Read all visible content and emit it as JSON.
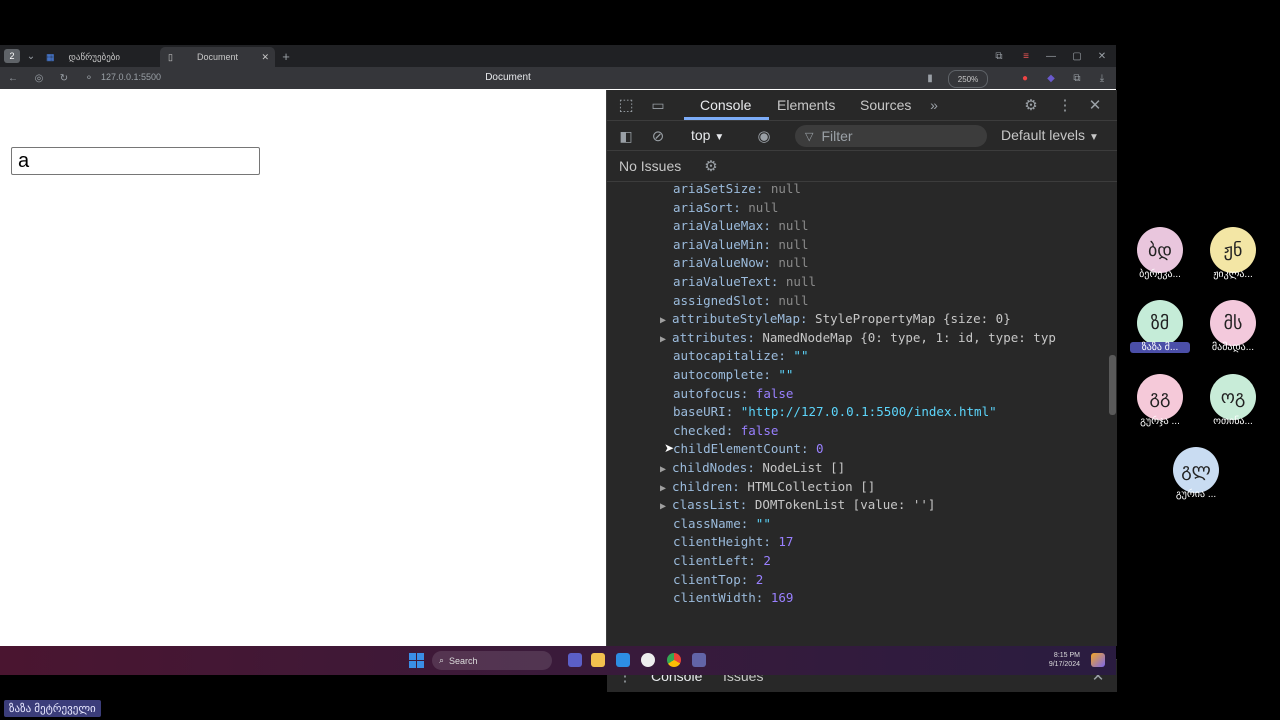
{
  "browser": {
    "tabs": [
      {
        "label": "დაწრუებები"
      },
      {
        "label": "Document"
      }
    ],
    "url": "127.0.0.1:5500",
    "page_title": "Document",
    "zoom": "250%"
  },
  "page": {
    "input_value": "a"
  },
  "devtools": {
    "tabs": [
      "Console",
      "Elements",
      "Sources"
    ],
    "context": "top",
    "filter_placeholder": "Filter",
    "levels": "Default levels",
    "issues": "No Issues",
    "drawer_tabs": [
      "Console",
      "Issues"
    ],
    "rows": [
      {
        "key": "ariaSetSize",
        "value": "null",
        "type": "null",
        "expand": false
      },
      {
        "key": "ariaSort",
        "value": "null",
        "type": "null",
        "expand": false
      },
      {
        "key": "ariaValueMax",
        "value": "null",
        "type": "null",
        "expand": false
      },
      {
        "key": "ariaValueMin",
        "value": "null",
        "type": "null",
        "expand": false
      },
      {
        "key": "ariaValueNow",
        "value": "null",
        "type": "null",
        "expand": false
      },
      {
        "key": "ariaValueText",
        "value": "null",
        "type": "null",
        "expand": false
      },
      {
        "key": "assignedSlot",
        "value": "null",
        "type": "null",
        "expand": false
      },
      {
        "key": "attributeStyleMap",
        "value": "StylePropertyMap {size: 0}",
        "type": "obj",
        "expand": true
      },
      {
        "key": "attributes",
        "value": "NamedNodeMap {0: type, 1: id, type: typ",
        "type": "obj",
        "expand": true
      },
      {
        "key": "autocapitalize",
        "value": "\"\"",
        "type": "str",
        "expand": false
      },
      {
        "key": "autocomplete",
        "value": "\"\"",
        "type": "str",
        "expand": false
      },
      {
        "key": "autofocus",
        "value": "false",
        "type": "bool",
        "expand": false
      },
      {
        "key": "baseURI",
        "value": "\"http://127.0.0.1:5500/index.html\"",
        "type": "str",
        "expand": false
      },
      {
        "key": "checked",
        "value": "false",
        "type": "bool",
        "expand": false
      },
      {
        "key": "childElementCount",
        "value": "0",
        "type": "num",
        "expand": false
      },
      {
        "key": "childNodes",
        "value": "NodeList []",
        "type": "obj",
        "expand": true
      },
      {
        "key": "children",
        "value": "HTMLCollection []",
        "type": "obj",
        "expand": true
      },
      {
        "key": "classList",
        "value": "DOMTokenList [value: '']",
        "type": "obj",
        "expand": true
      },
      {
        "key": "className",
        "value": "\"\"",
        "type": "str",
        "expand": false
      },
      {
        "key": "clientHeight",
        "value": "17",
        "type": "num",
        "expand": false
      },
      {
        "key": "clientLeft",
        "value": "2",
        "type": "num",
        "expand": false
      },
      {
        "key": "clientTop",
        "value": "2",
        "type": "num",
        "expand": false
      },
      {
        "key": "clientWidth",
        "value": "169",
        "type": "num",
        "expand": false
      }
    ]
  },
  "taskbar": {
    "search": "Search",
    "time": "8:15 PM",
    "date": "9/17/2024"
  },
  "participants": [
    {
      "initials": "ბდ",
      "name": "ბერეკა...",
      "color": "#e9c6dd"
    },
    {
      "initials": "ჟნ",
      "name": "ჟიკლა...",
      "color": "#f3e6a5"
    },
    {
      "initials": "ზმ",
      "name": "ზაზა მ...",
      "color": "#c5ecd8",
      "active": true
    },
    {
      "initials": "მს",
      "name": "მამადა...",
      "color": "#f3c9dc"
    },
    {
      "initials": "გგ",
      "name": "გურჯა ...",
      "color": "#f5c9d9"
    },
    {
      "initials": "ოგ",
      "name": "ოთინა...",
      "color": "#c8ecd8"
    },
    {
      "initials": "გლ",
      "name": "გურია ...",
      "color": "#c9dcf2"
    }
  ],
  "me_badge": "ზაზა მეტრეველი"
}
